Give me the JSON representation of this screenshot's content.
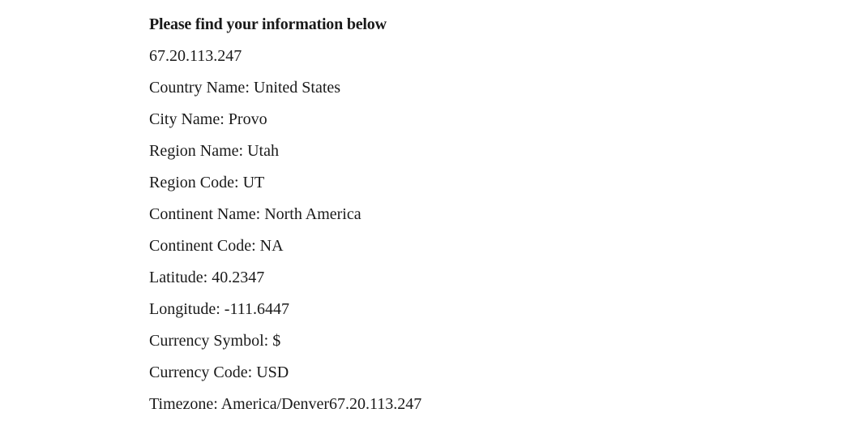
{
  "heading": "Please find your information below",
  "ip": "67.20.113.247",
  "fields": [
    {
      "label": "Country Name",
      "value": "United States"
    },
    {
      "label": "City Name",
      "value": "Provo"
    },
    {
      "label": "Region Name",
      "value": "Utah"
    },
    {
      "label": "Region Code",
      "value": "UT"
    },
    {
      "label": "Continent Name",
      "value": "North America"
    },
    {
      "label": "Continent Code",
      "value": "NA"
    },
    {
      "label": "Latitude",
      "value": "40.2347"
    },
    {
      "label": "Longitude",
      "value": "-111.6447"
    },
    {
      "label": "Currency Symbol",
      "value": "$"
    },
    {
      "label": "Currency Code",
      "value": "USD"
    },
    {
      "label": "Timezone",
      "value": "America/Denver67.20.113.247"
    }
  ]
}
